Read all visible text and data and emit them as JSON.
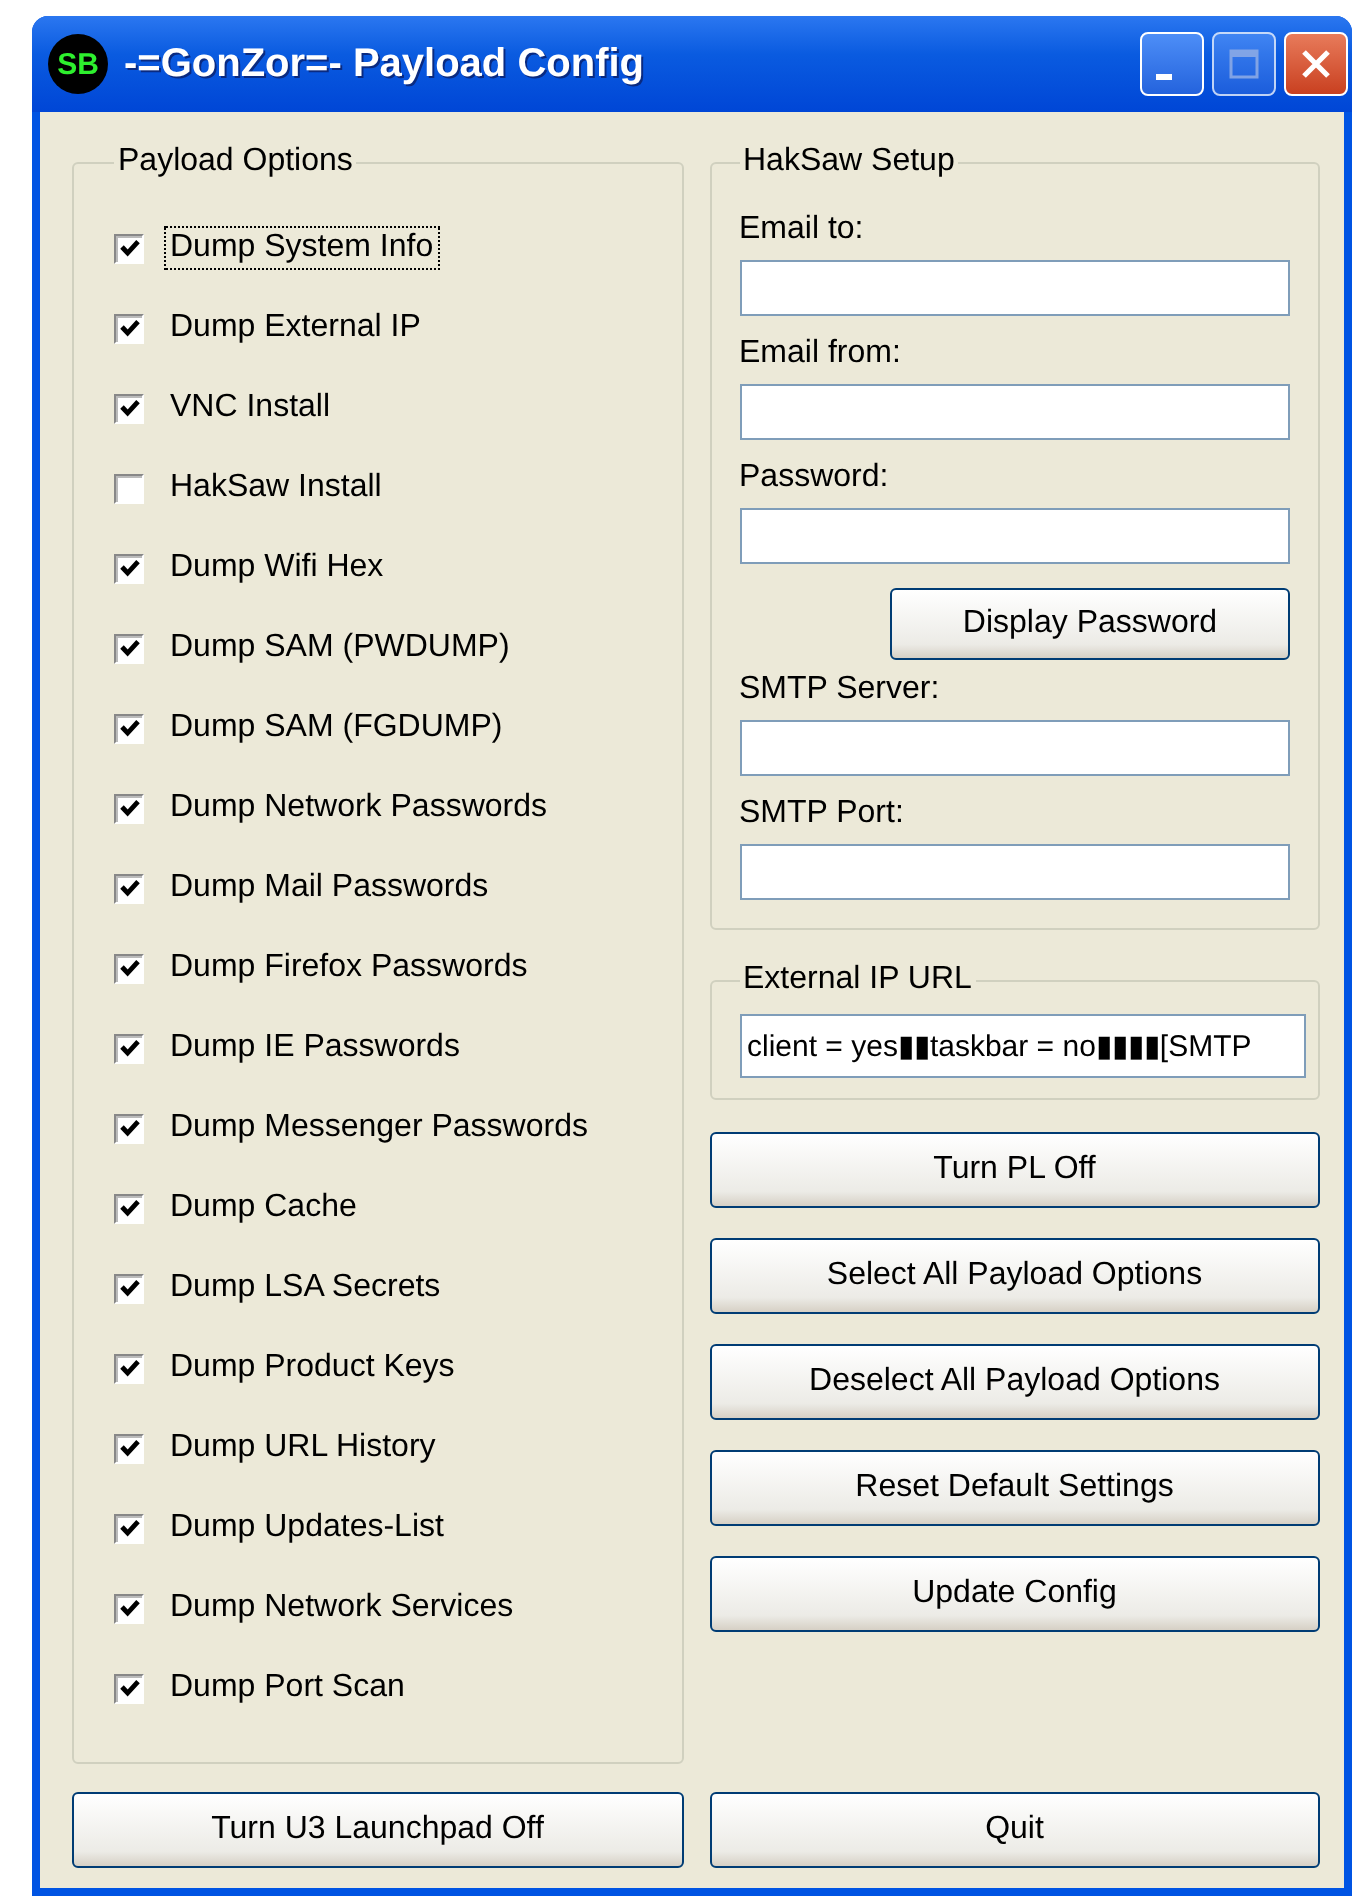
{
  "window": {
    "title": "-=GonZor=- Payload Config",
    "logo": "SB"
  },
  "payload_options": {
    "title": "Payload Options",
    "items": [
      {
        "label": "Dump System Info",
        "checked": true,
        "focused": true
      },
      {
        "label": "Dump External IP",
        "checked": true,
        "focused": false
      },
      {
        "label": "VNC Install",
        "checked": true,
        "focused": false
      },
      {
        "label": "HakSaw Install",
        "checked": false,
        "focused": false
      },
      {
        "label": "Dump Wifi Hex",
        "checked": true,
        "focused": false
      },
      {
        "label": "Dump SAM (PWDUMP)",
        "checked": true,
        "focused": false
      },
      {
        "label": "Dump SAM (FGDUMP)",
        "checked": true,
        "focused": false
      },
      {
        "label": "Dump Network Passwords",
        "checked": true,
        "focused": false
      },
      {
        "label": "Dump Mail Passwords",
        "checked": true,
        "focused": false
      },
      {
        "label": "Dump Firefox Passwords",
        "checked": true,
        "focused": false
      },
      {
        "label": "Dump IE Passwords",
        "checked": true,
        "focused": false
      },
      {
        "label": "Dump Messenger Passwords",
        "checked": true,
        "focused": false
      },
      {
        "label": "Dump Cache",
        "checked": true,
        "focused": false
      },
      {
        "label": "Dump LSA Secrets",
        "checked": true,
        "focused": false
      },
      {
        "label": "Dump Product Keys",
        "checked": true,
        "focused": false
      },
      {
        "label": "Dump URL History",
        "checked": true,
        "focused": false
      },
      {
        "label": "Dump Updates-List",
        "checked": true,
        "focused": false
      },
      {
        "label": "Dump Network Services",
        "checked": true,
        "focused": false
      },
      {
        "label": "Dump Port Scan",
        "checked": true,
        "focused": false
      }
    ]
  },
  "haksaw_setup": {
    "title": "HakSaw Setup",
    "rows": [
      {
        "kind": "field",
        "label": "Email to:"
      },
      {
        "kind": "field",
        "label": "Email from:"
      },
      {
        "kind": "field",
        "label": "Password:"
      },
      {
        "kind": "button",
        "label": "Display Password"
      },
      {
        "kind": "field",
        "label": "SMTP Server:"
      },
      {
        "kind": "field",
        "label": "SMTP Port:"
      }
    ]
  },
  "external_ip_url": {
    "title": "External IP URL",
    "value": "client = yes▮▮taskbar = no▮▮▮▮[SMTP"
  },
  "buttons": [
    "Turn PL Off",
    "Select All Payload Options",
    "Deselect All Payload Options",
    "Reset Default Settings",
    "Update Config"
  ],
  "bottom_buttons": [
    "Turn U3 Launchpad Off",
    "Quit"
  ]
}
